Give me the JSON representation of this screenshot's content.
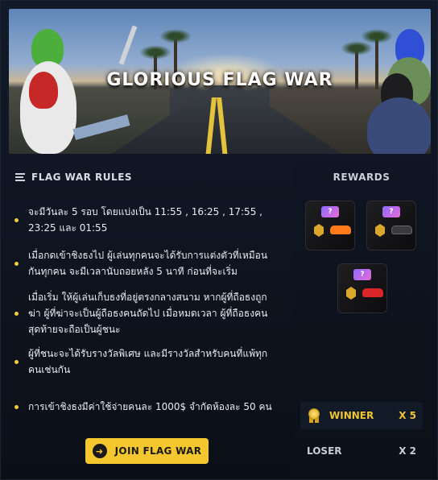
{
  "banner": {
    "title": "GLORIOUS FLAG WAR"
  },
  "rules": {
    "heading": "FLAG WAR RULES",
    "items": [
      "จะมีวันละ 5 รอบ โดยแบ่งเป็น 11:55 , 16:25 , 17:55 , 23:25 และ 01:55",
      "เมื่อกดเข้าชิงธงไป ผู้เล่นทุกคนจะได้รับการแต่งตัวที่เหมือนกันทุกคน จะมีเวลานับถอยหลัง 5 นาที ก่อนที่จะเริ่ม",
      "เมื่อเริ่ม ให้ผู้เล่นเก็บธงที่อยู่ตรงกลางสนาม หากผู้ที่ถือธงถูกฆ่า ผู้ที่ฆ่าจะเป็นผู้ถือธงคนถัดไป เมื่อหมดเวลา ผู้ที่ถือธงคนสุดท้ายจะถือเป็นผู้ชนะ",
      "ผู้ที่ชนะจะได้รับรางวัลพิเศษ และมีรางวัลสำหรับคนที่แพ้ทุกคนเช่นกัน",
      "การเข้าชิงธงมีค่าใช้จ่ายคนละ 1000$ จำกัดห้องละ 50 คน"
    ]
  },
  "join_button": {
    "label": "JOIN FLAG WAR"
  },
  "rewards": {
    "title": "REWARDS",
    "boxes": [
      {
        "mark": "?",
        "car_color": "#ff7a1a"
      },
      {
        "mark": "?",
        "car_color": "#3a3a3f"
      },
      {
        "mark": "?",
        "car_color": "#d9262b"
      }
    ],
    "winner": {
      "label": "WINNER",
      "count": "X 5"
    },
    "loser": {
      "label": "LOSER",
      "count": "X 2"
    }
  },
  "colors": {
    "accent": "#f5c72e",
    "background": "#0c111b"
  }
}
